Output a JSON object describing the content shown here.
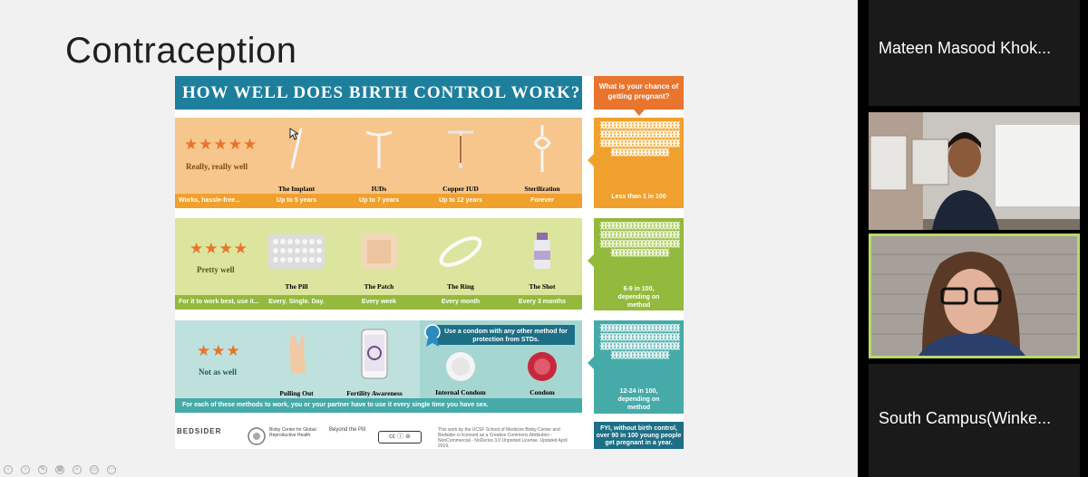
{
  "slide": {
    "title": "Contraception"
  },
  "infographic": {
    "banner": "HOW WELL DOES BIRTH CONTROL WORK?",
    "chance_header": "What is your chance of getting pregnant?",
    "tiers": [
      {
        "stars": "★★★★★",
        "rating": "Really, really well",
        "methods": [
          "The Implant",
          "IUDs",
          "Copper IUD",
          "Sterilization"
        ],
        "footer_lead": "Works, hassle-free...",
        "footer_values": [
          "Up to 5 years",
          "Up to 7 years",
          "Up to 12 years",
          "Forever"
        ],
        "chance": "Less than 1 in 100"
      },
      {
        "stars": "★★★★",
        "rating": "Pretty well",
        "methods": [
          "The Pill",
          "The Patch",
          "The Ring",
          "The Shot"
        ],
        "footer_lead": "For it to work best, use it...",
        "footer_values": [
          "Every. Single. Day.",
          "Every week",
          "Every month",
          "Every 3 months"
        ],
        "chance": "6-9 in 100, depending on method"
      },
      {
        "stars": "★★★",
        "rating": "Not as well",
        "methods": [
          "Pulling Out",
          "Fertility Awareness",
          "Internal Condom",
          "Condom"
        ],
        "condom_note": "Use a condom with any other method for protection from STDs.",
        "footer": "For each of these methods to work, you or your partner have to use it every single time you have sex.",
        "chance": "12-24 in 100, depending on method"
      }
    ],
    "fyi": "FYI, without birth control, over 90 in 100 young people get pregnant in a year.",
    "logos": [
      "BEDSIDER",
      "Bixby Center for Global Reproductive Health",
      "Beyond the Pill"
    ],
    "license": "This work by the UCSF School of Medicine Bixby Center and Bedsider is licensed as a Creative Commons Attribution - NonCommercial - NoDerivs 3.0 Unported License. Updated April 2019."
  },
  "participants": [
    {
      "name": "Mateen Masood Khok..."
    },
    {
      "name": ""
    },
    {
      "name": ""
    },
    {
      "name": "South Campus(Winke..."
    }
  ],
  "colors": {
    "teal": "#1d7f9c",
    "orange": "#e8742d",
    "tier1": "#f0a02c",
    "tier2": "#93ba3d",
    "tier3": "#46aaa8",
    "active_speaker_border": "#b9d96b"
  }
}
